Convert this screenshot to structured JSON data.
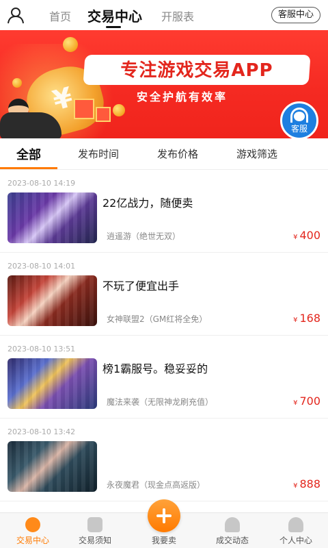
{
  "header": {
    "user_icon": "user-icon",
    "tabs": [
      {
        "label": "首页"
      },
      {
        "label": "交易中心"
      },
      {
        "label": "开服表"
      }
    ],
    "customer_service_label": "客服中心"
  },
  "banner": {
    "title": "专注游戏交易APP",
    "subtitle": "安全护航有效率",
    "cs_float_label": "客服",
    "colors": {
      "background": "#f52a22",
      "title": "#e3261d"
    }
  },
  "filters": {
    "tabs": [
      {
        "label": "全部"
      },
      {
        "label": "发布时间"
      },
      {
        "label": "发布价格"
      },
      {
        "label": "游戏筛选"
      }
    ],
    "accent_color": "#ff7a00"
  },
  "listings": [
    {
      "date": "2023-08-10 14:19",
      "title": "22亿战力，随便卖",
      "game": "逍遥游（绝世无双）",
      "currency": "¥",
      "price": "400"
    },
    {
      "date": "2023-08-10 14:01",
      "title": "不玩了便宜出手",
      "game": "女神联盟2（GM红将全免）",
      "currency": "¥",
      "price": "168"
    },
    {
      "date": "2023-08-10 13:51",
      "title": "榜1霸服号。稳妥妥的",
      "game": "魔法来袭（无限神龙刷充值）",
      "currency": "¥",
      "price": "700"
    },
    {
      "date": "2023-08-10 13:42",
      "title": "",
      "game": "永夜魔君（现金点高返版）",
      "currency": "¥",
      "price": "888"
    }
  ],
  "bottom_nav": {
    "items": [
      {
        "label": "交易中心",
        "icon": "trade-center-icon"
      },
      {
        "label": "交易须知",
        "icon": "notice-icon"
      },
      {
        "label": "我要卖",
        "icon": "plus-icon"
      },
      {
        "label": "成交动态",
        "icon": "bell-icon"
      },
      {
        "label": "个人中心",
        "icon": "person-icon"
      }
    ],
    "active_color": "#ff7a00"
  }
}
